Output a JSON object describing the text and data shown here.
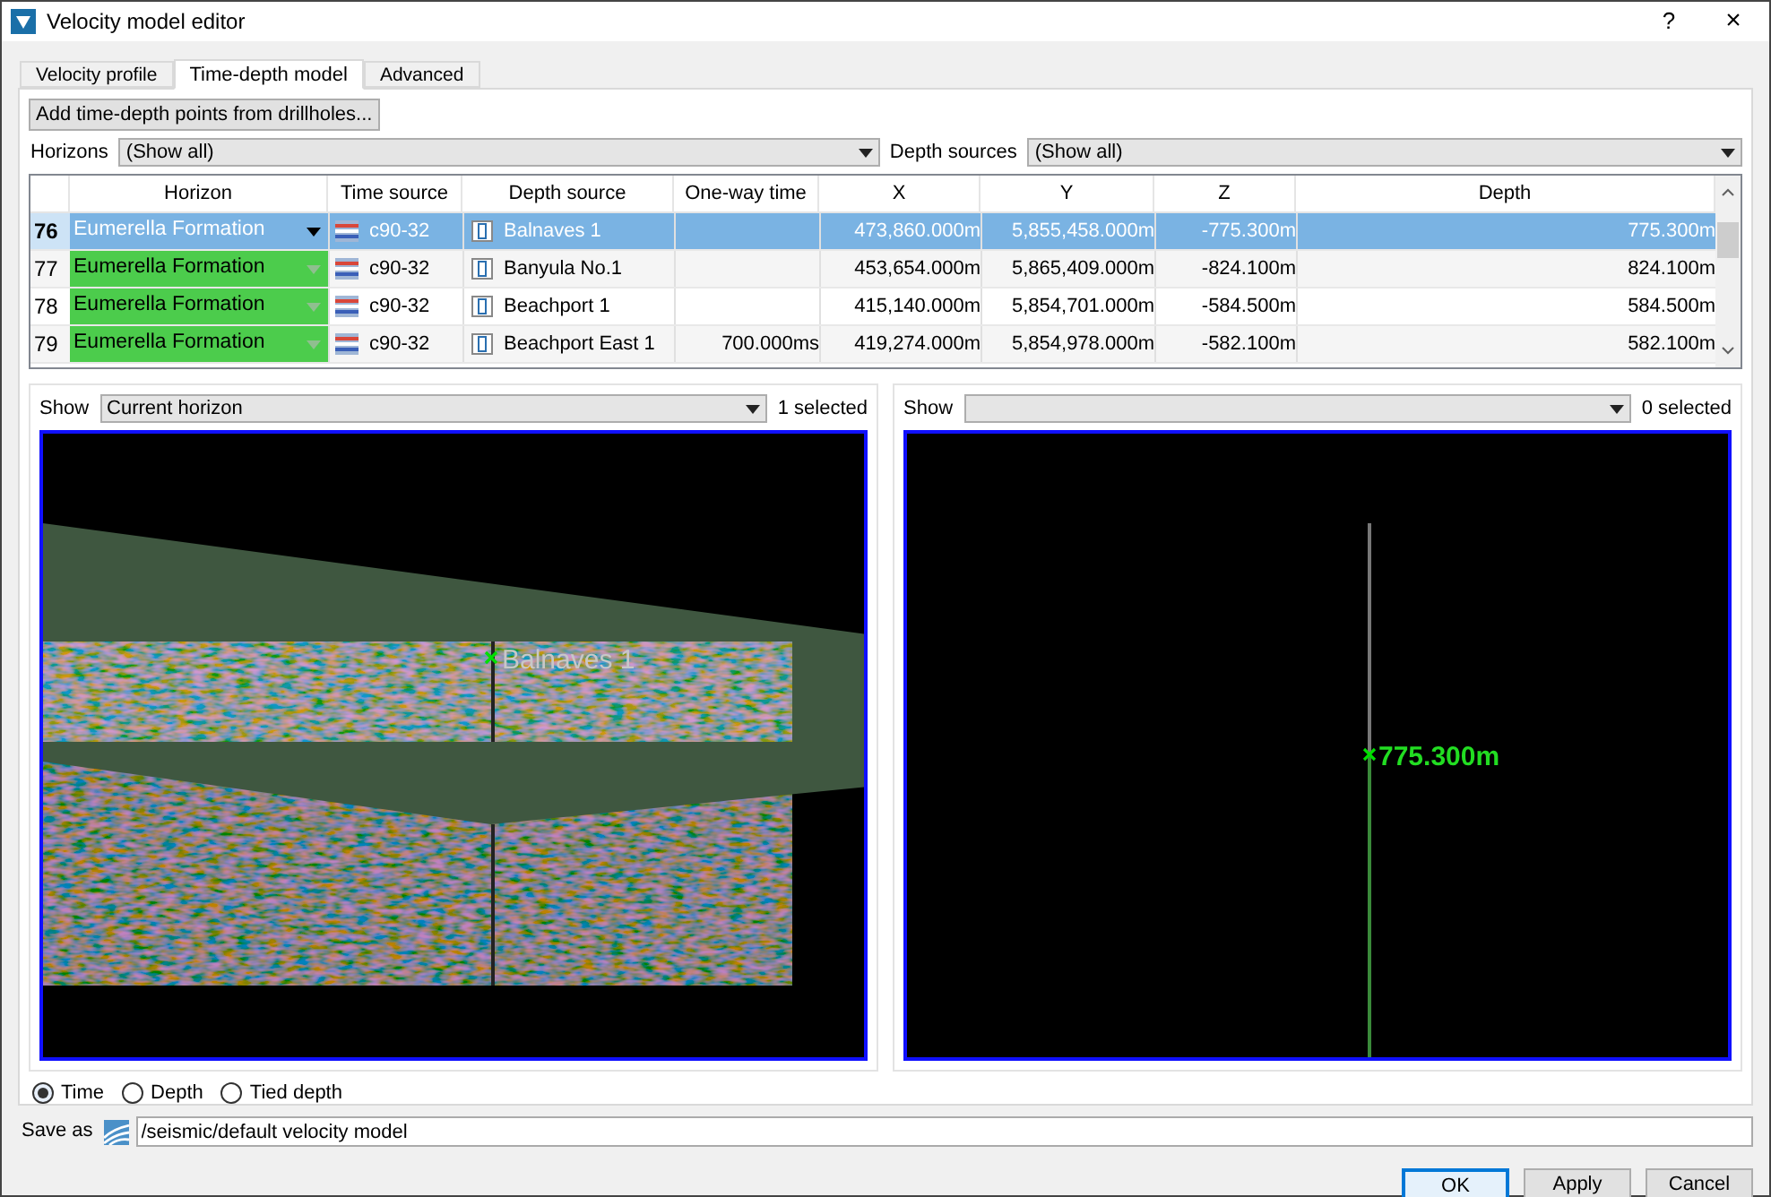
{
  "window": {
    "title": "Velocity model editor",
    "help": "?",
    "close": "×"
  },
  "tabs": [
    {
      "label": "Velocity profile",
      "selected": false
    },
    {
      "label": "Time-depth model",
      "selected": true
    },
    {
      "label": "Advanced",
      "selected": false
    }
  ],
  "add_button": "Add time-depth points from drillholes...",
  "filters": [
    {
      "label": "Horizons",
      "value": "(Show all)"
    },
    {
      "label": "Depth sources",
      "value": "(Show all)"
    }
  ],
  "table": {
    "columns": [
      "Horizon",
      "Time source",
      "Depth source",
      "One-way time",
      "X",
      "Y",
      "Z",
      "Depth"
    ],
    "rows": [
      {
        "index": "76",
        "selected": true,
        "horizon": "Eumerella Formation",
        "time_source": "c90-32",
        "depth_source": "Balnaves 1",
        "x": "473,860.000m",
        "y": "5,855,458.000m",
        "z": "-775.300m",
        "depth": "775.300m"
      },
      {
        "index": "77",
        "selected": false,
        "horizon": "Eumerella Formation",
        "time_source": "c90-32",
        "depth_source": "Banyula No.1",
        "x": "453,654.000m",
        "y": "5,865,409.000m",
        "z": "-824.100m",
        "depth": "824.100m"
      },
      {
        "index": "78",
        "selected": false,
        "horizon": "Eumerella Formation",
        "time_source": "c90-32",
        "depth_source": "Beachport 1",
        "x": "415,140.000m",
        "y": "5,854,701.000m",
        "z": "-584.500m",
        "depth": "584.500m"
      },
      {
        "index": "79",
        "selected": false,
        "horizon": "Eumerella Formation",
        "time_source": "c90-32",
        "depth_source": "Beachport East 1",
        "one_way_time": "700.000ms",
        "x": "419,274.000m",
        "y": "5,854,978.000m",
        "z": "-582.100m",
        "depth": "582.100m"
      }
    ]
  },
  "views": [
    {
      "kind": "section",
      "show_label": "Show",
      "show_value": "Current horizon",
      "selected_count": "1 selected",
      "well_label": "Balnaves 1"
    },
    {
      "kind": "well",
      "show_label": "Show",
      "selected_count": "0 selected",
      "depth_label": "775.300m"
    }
  ],
  "display_mode": [
    {
      "label": "Time",
      "selected": true
    },
    {
      "label": "Depth",
      "selected": false
    },
    {
      "label": "Tied depth",
      "selected": false
    }
  ],
  "save_as": {
    "label": "Save as",
    "value": "/seismic/default velocity model"
  },
  "buttons": [
    {
      "label": "OK",
      "default": true
    },
    {
      "label": "Apply",
      "default": false
    },
    {
      "label": "Cancel",
      "default": false
    }
  ]
}
